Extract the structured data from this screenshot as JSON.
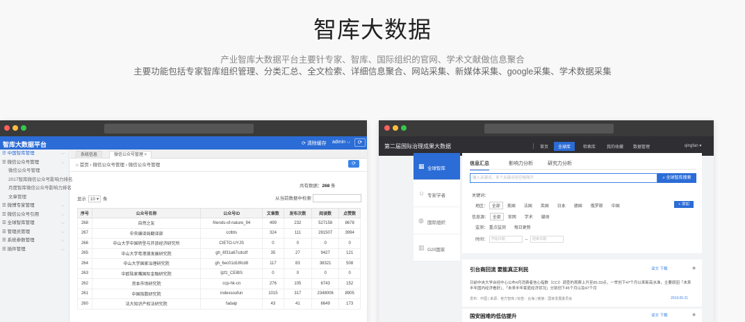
{
  "hero": {
    "title": "智库大数据",
    "line1": "产业智库大数据平台主要针专家、智库、国际组织的官网、学术文献做信息聚合",
    "line2": "主要功能包括专家智库组织管理、分类汇总、全文检索、详细信息聚合、网站采集、新媒体采集、google采集、学术数据采集"
  },
  "colors": {
    "accent": "#2b6cd6",
    "dot_red": "#fc605c",
    "dot_yellow": "#fdbc40",
    "dot_green": "#34c84a"
  },
  "left": {
    "app_title": "智库大数据平台",
    "clear_cache": "清除缓存",
    "admin": "admin ⌵",
    "sidebar": [
      {
        "label": "中国智库管理",
        "sub": false,
        "active": true
      },
      {
        "label": "微信公众号管理",
        "sub": false,
        "active": false
      },
      {
        "label": "微信公众号管理",
        "sub": true,
        "active": false
      },
      {
        "label": "2017智库微信公众号影响力排名",
        "sub": true,
        "active": false
      },
      {
        "label": "月度智库微信公众号影响力排名",
        "sub": true,
        "active": false
      },
      {
        "label": "文章管理",
        "sub": true,
        "active": false
      },
      {
        "label": "微博专家管理",
        "sub": false,
        "active": false
      },
      {
        "label": "微信公众号引用",
        "sub": false,
        "active": false
      },
      {
        "label": "全球智库管理",
        "sub": false,
        "active": false
      },
      {
        "label": "管理员管理",
        "sub": false,
        "active": false
      },
      {
        "label": "系统参数管理",
        "sub": false,
        "active": false
      },
      {
        "label": "插件管理",
        "sub": false,
        "active": false
      }
    ],
    "tabs": [
      "系统信息",
      "微信公众号管理"
    ],
    "breadcrumb": "首页 › 微信公众号管理 › 微信公众号管理",
    "total_label": "共有数据：",
    "total_value": "268",
    "total_unit": "条",
    "show_label": "显示",
    "show_value": "10",
    "show_unit": "条",
    "search_label": "从当前数据中检索",
    "columns": [
      "序号",
      "公众号名称",
      "公众号ID",
      "文章数",
      "发布次数",
      "阅读数",
      "点赞数"
    ],
    "rows": [
      [
        "268",
        "自然之友",
        "friends-of-nature_94",
        "499",
        "232",
        "527158",
        "8678"
      ],
      [
        "267",
        "中央编译局翻译部",
        "cctbts",
        "324",
        "111",
        "281507",
        "3994"
      ],
      [
        "266",
        "中山大学中国转型与开放经济研究所",
        "CIETO-UYJS",
        "0",
        "0",
        "0",
        "0"
      ],
      [
        "265",
        "中山大学粤港澳发展研究院",
        "gh_6f31a67cdcdf",
        "35",
        "27",
        "9427",
        "121"
      ],
      [
        "264",
        "中山大学国家治理研究院",
        "gh_6ec01d16fcd8",
        "117",
        "83",
        "38321",
        "508"
      ],
      [
        "263",
        "中欧陆家嘴国际金融研究院",
        "ljzfz_CEIBS",
        "0",
        "0",
        "0",
        "0"
      ],
      [
        "262",
        "资本市场研究院",
        "ccp-hk-cn",
        "276",
        "105",
        "6743",
        "152"
      ],
      [
        "261",
        "中国指数研究院",
        "indexsoufun",
        "1015",
        "317",
        "2348006",
        "8905"
      ],
      [
        "260",
        "法大知识产权法研究院",
        "fadaip",
        "43",
        "41",
        "6649",
        "173"
      ]
    ]
  },
  "right": {
    "logo": "第二届国际治理成果大数据",
    "nav": [
      "首页",
      "全球库",
      "检索库",
      "我的收藏",
      "数据管理"
    ],
    "user": "qingfan ▾",
    "side": [
      "全球智库",
      "专家学者",
      "国际组织",
      "G20国家"
    ],
    "tabs": [
      "信息汇总",
      "影响力分析",
      "研究力分析"
    ],
    "search_placeholder": "输入关键词，多个关键词用空格隔开",
    "search_button": "全球智库搜索",
    "keyword_label": "关键词：",
    "region_label": "地区：",
    "regions": [
      "全部",
      "美国",
      "法国",
      "英国",
      "日本",
      "德国",
      "俄罗斯",
      "中国"
    ],
    "add_button": "+ 添加",
    "source_label": "信息源：",
    "sources": [
      "全部",
      "官网",
      "学术",
      "媒体"
    ],
    "monitor_label": "监测：",
    "monitors": [
      "重点监测",
      "每日更新"
    ],
    "time_label": "时间：",
    "time_start": "开始日期",
    "time_end": "结束日期",
    "cards": [
      {
        "title": "引台商回流 要能真正利民",
        "actions": "译文  下载",
        "text": "日前中央大学台经中心公布4月消费者信心指数（CCI）调查的观察上升至85.33点，一举创下47个月以来新高水准，主要原因「未来半年国内经济看好」、「未来半年家庭经济状况」分别创下45个月以及47个月",
        "meta": "发布：中国 | 来源：官方智库 | 标签：台海 | 链接：国家发展委员会",
        "date": "2019.05.21"
      },
      {
        "title": "国安困难的低估提升",
        "actions": "译文  下载"
      }
    ]
  }
}
